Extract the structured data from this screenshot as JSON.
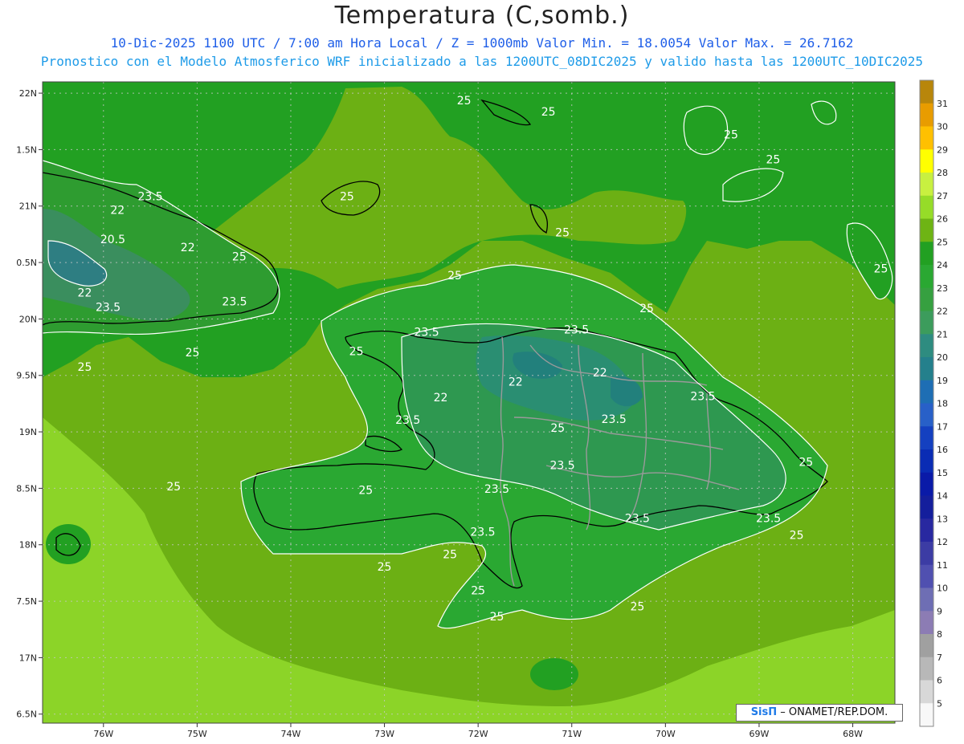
{
  "header": {
    "title": "Temperatura (C,somb.)",
    "line1": "10-Dic-2025  1100 UTC / 7:00 am Hora Local / Z = 1000mb   Valor Min. = 18.0054  Valor Max. = 26.7162",
    "line2": "Pronostico con el Modelo Atmosferico WRF inicializado a las 1200UTC_08DIC2025 y valido hasta las  1200UTC_10DIC2025"
  },
  "axes": {
    "lat_labels": [
      "22N",
      "1.5N",
      "21N",
      "0.5N",
      "20N",
      "9.5N",
      "19N",
      "8.5N",
      "18N",
      "7.5N",
      "17N",
      "6.5N"
    ],
    "lat_values": [
      22,
      21.5,
      21,
      20.5,
      20,
      19.5,
      19,
      18.5,
      18,
      17.5,
      17,
      16.5
    ],
    "lon_labels": [
      "76W",
      "75W",
      "74W",
      "73W",
      "72W",
      "71W",
      "70W",
      "69W",
      "68W"
    ],
    "lon_values": [
      -76,
      -75,
      -74,
      -73,
      -72,
      -71,
      -70,
      -69,
      -68
    ]
  },
  "colorbar": {
    "labels": [
      "31",
      "30",
      "29",
      "28",
      "27",
      "26",
      "25",
      "24",
      "23",
      "22",
      "21",
      "20",
      "19",
      "18",
      "17",
      "16",
      "15",
      "14",
      "13",
      "12",
      "11",
      "10",
      "9",
      "8",
      "7",
      "6",
      "5"
    ],
    "colors": [
      "#b8860b",
      "#e89c00",
      "#ffc000",
      "#ffff00",
      "#c8f040",
      "#96dc28",
      "#6eb414",
      "#22a022",
      "#2aa832",
      "#36a040",
      "#3c9c5c",
      "#2e8c80",
      "#24808c",
      "#1e6eb4",
      "#2860c8",
      "#1440c0",
      "#0a2cb4",
      "#0a1aa8",
      "#141e9c",
      "#2828a0",
      "#3c3ca4",
      "#5050b0",
      "#6e6eb4",
      "#8c7cb4",
      "#a0a0a0",
      "#b8b8b8",
      "#d8d8d8",
      "#f8f8f8"
    ]
  },
  "contour_labels": [
    {
      "text": "25",
      "lon": -72.15,
      "lat": 21.9
    },
    {
      "text": "25",
      "lon": -71.25,
      "lat": 21.8
    },
    {
      "text": "25",
      "lon": -69.3,
      "lat": 21.6
    },
    {
      "text": "25",
      "lon": -68.85,
      "lat": 21.38
    },
    {
      "text": "25",
      "lon": -73.4,
      "lat": 21.05
    },
    {
      "text": "25",
      "lon": -71.1,
      "lat": 20.73
    },
    {
      "text": "23.5",
      "lon": -75.5,
      "lat": 21.05
    },
    {
      "text": "22",
      "lon": -75.85,
      "lat": 20.93
    },
    {
      "text": "20.5",
      "lon": -75.9,
      "lat": 20.67
    },
    {
      "text": "22",
      "lon": -75.1,
      "lat": 20.6
    },
    {
      "text": "25",
      "lon": -74.55,
      "lat": 20.52
    },
    {
      "text": "25",
      "lon": -72.25,
      "lat": 20.35
    },
    {
      "text": "25",
      "lon": -67.7,
      "lat": 20.41
    },
    {
      "text": "22",
      "lon": -76.2,
      "lat": 20.2
    },
    {
      "text": "23.5",
      "lon": -75.95,
      "lat": 20.07
    },
    {
      "text": "23.5",
      "lon": -74.6,
      "lat": 20.12
    },
    {
      "text": "25",
      "lon": -70.2,
      "lat": 20.06
    },
    {
      "text": "25",
      "lon": -75.05,
      "lat": 19.67
    },
    {
      "text": "25",
      "lon": -76.2,
      "lat": 19.54
    },
    {
      "text": "25",
      "lon": -73.3,
      "lat": 19.68
    },
    {
      "text": "23.5",
      "lon": -72.55,
      "lat": 19.85
    },
    {
      "text": "23.5",
      "lon": -70.95,
      "lat": 19.87
    },
    {
      "text": "22",
      "lon": -70.7,
      "lat": 19.49
    },
    {
      "text": "22",
      "lon": -71.6,
      "lat": 19.41
    },
    {
      "text": "22",
      "lon": -72.4,
      "lat": 19.27
    },
    {
      "text": "23.5",
      "lon": -72.75,
      "lat": 19.07
    },
    {
      "text": "23.5",
      "lon": -69.6,
      "lat": 19.28
    },
    {
      "text": "23.5",
      "lon": -70.55,
      "lat": 19.08
    },
    {
      "text": "25",
      "lon": -71.15,
      "lat": 19.0
    },
    {
      "text": "23.5",
      "lon": -71.1,
      "lat": 18.67
    },
    {
      "text": "25",
      "lon": -68.5,
      "lat": 18.7
    },
    {
      "text": "25",
      "lon": -75.25,
      "lat": 18.48
    },
    {
      "text": "25",
      "lon": -73.2,
      "lat": 18.45
    },
    {
      "text": "23.5",
      "lon": -71.8,
      "lat": 18.46
    },
    {
      "text": "23.5",
      "lon": -70.3,
      "lat": 18.2
    },
    {
      "text": "23.5",
      "lon": -68.9,
      "lat": 18.2
    },
    {
      "text": "25",
      "lon": -68.6,
      "lat": 18.05
    },
    {
      "text": "23.5",
      "lon": -71.95,
      "lat": 18.08
    },
    {
      "text": "25",
      "lon": -72.3,
      "lat": 17.88
    },
    {
      "text": "25",
      "lon": -73.0,
      "lat": 17.77
    },
    {
      "text": "25",
      "lon": -72.0,
      "lat": 17.56
    },
    {
      "text": "25",
      "lon": -71.8,
      "lat": 17.33
    },
    {
      "text": "25",
      "lon": -70.3,
      "lat": 17.42
    }
  ],
  "credit": {
    "logo": "SisΠ",
    "text": "– ONAMET/REP.DOM."
  }
}
